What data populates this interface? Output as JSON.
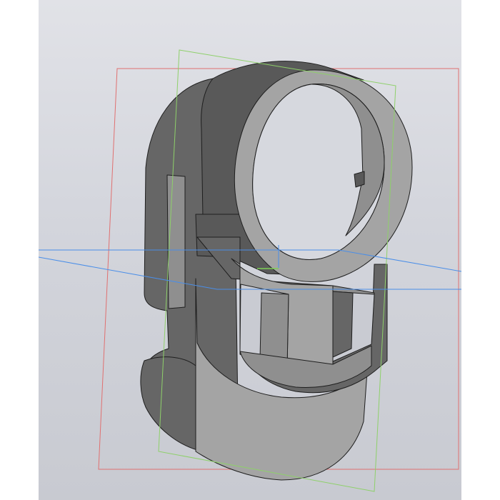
{
  "viewport": {
    "background_top": "#e1e2e7",
    "background_bottom": "#c8cad1",
    "model": {
      "name": "ring-clip-part",
      "face_light": "#a4a4a4",
      "face_mid": "#8f8f8f",
      "face_dark": "#666666",
      "face_darker": "#595959",
      "edge_color": "#1e1e1e"
    },
    "planes": [
      {
        "name": "plane-red",
        "color": "#e07070"
      },
      {
        "name": "plane-green",
        "color": "#8ed06a"
      },
      {
        "name": "plane-blue",
        "color": "#4a8ee8"
      }
    ],
    "origin_color": "#7ccf55"
  }
}
